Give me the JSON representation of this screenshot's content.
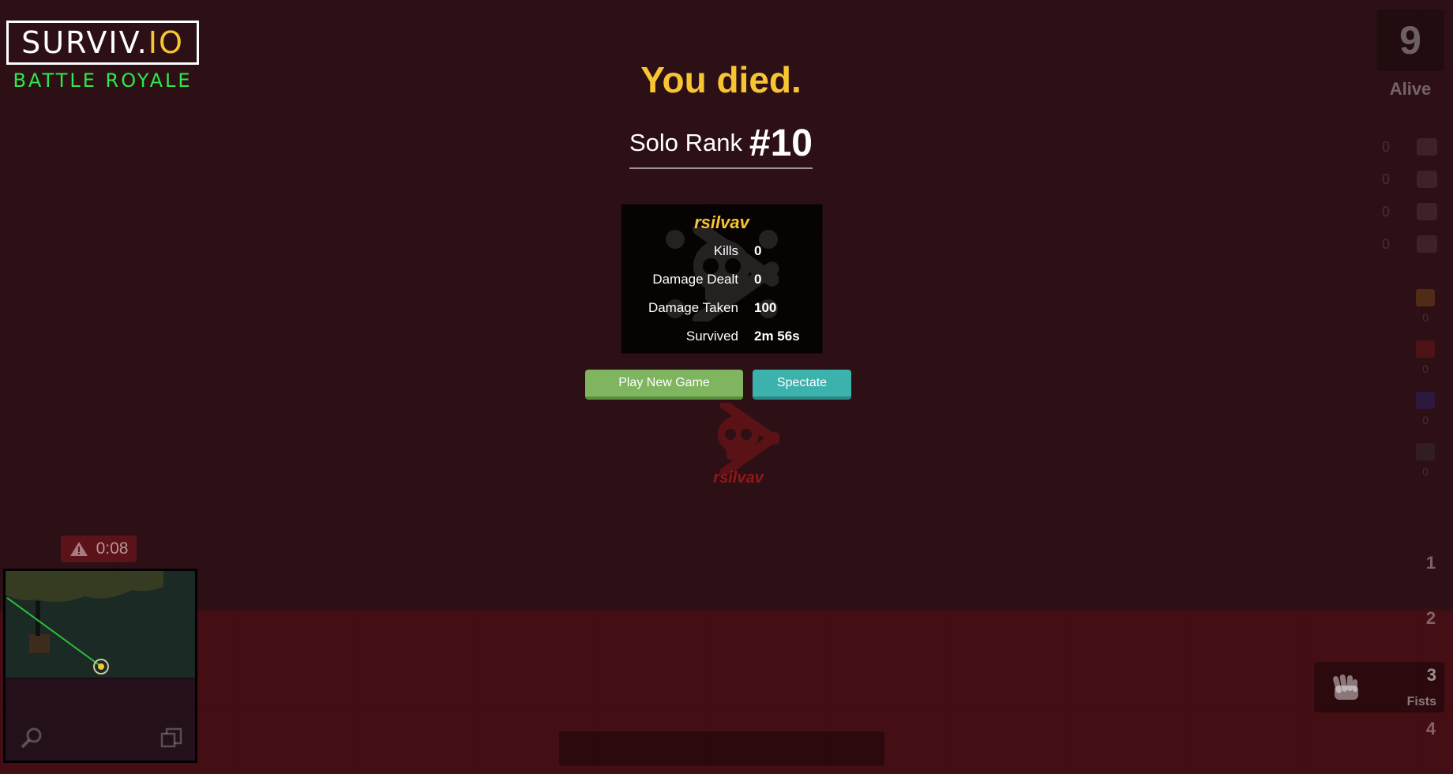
{
  "logo": {
    "main": "SURVIV.",
    "main_accent": "IO",
    "subtitle": "BATTLE ROYALE"
  },
  "alive": {
    "count": "9",
    "label": "Alive"
  },
  "side_items": [
    {
      "count": "0",
      "icon": "bandage-icon"
    },
    {
      "count": "0",
      "icon": "medkit-icon"
    },
    {
      "count": "0",
      "icon": "soda-icon"
    },
    {
      "count": "0",
      "icon": "pills-icon"
    }
  ],
  "ammo": [
    {
      "count": "0",
      "color": "#c47a1f"
    },
    {
      "count": "0",
      "color": "#8a1a1a"
    },
    {
      "count": "0",
      "color": "#2a2a8a"
    },
    {
      "count": "0",
      "color": "#3a3a3a"
    }
  ],
  "death": {
    "title": "You died.",
    "rank_label": "Solo Rank",
    "rank_value": "#10",
    "player_name": "rsilvav",
    "stats": [
      {
        "label": "Kills",
        "value": "0"
      },
      {
        "label": "Damage Dealt",
        "value": "0"
      },
      {
        "label": "Damage Taken",
        "value": "100"
      },
      {
        "label": "Survived",
        "value": "2m 56s"
      }
    ],
    "play_button": "Play New Game",
    "spectate_button": "Spectate"
  },
  "ghost_name": "rsilvav",
  "gas": {
    "timer": "0:08"
  },
  "weapon_slots": {
    "slot1": "1",
    "slot2": "2",
    "slot3": "3",
    "slot3_name": "Fists",
    "slot4": "4"
  },
  "colors": {
    "accent_yellow": "#f7c531",
    "logo_green": "#2ee84a",
    "play_green": "#7fb55f",
    "spectate_teal": "#3cb2ad"
  }
}
